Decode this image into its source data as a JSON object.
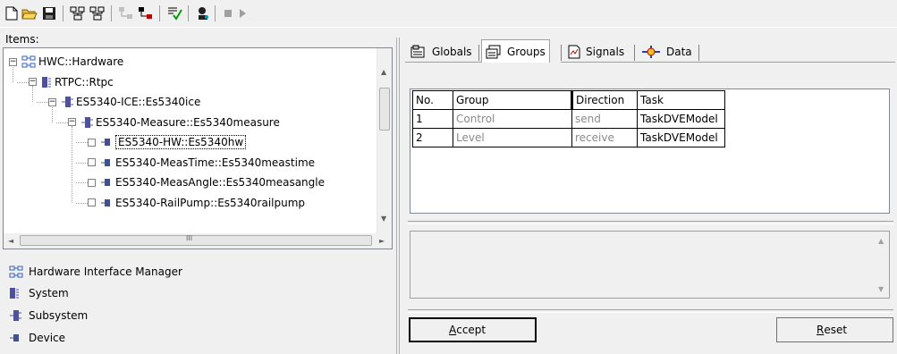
{
  "toolbar": {
    "icons": [
      "new-file-icon",
      "open-folder-icon",
      "save-icon",
      "hardware-config-icon",
      "hardware-config-alt-icon",
      "disabled-network-icon",
      "network-icon",
      "check-icon",
      "user-icon",
      "stop-icon",
      "play-icon"
    ]
  },
  "items_label": "Items:",
  "tree": [
    {
      "label": "HWC::Hardware",
      "level": 0,
      "type": "hardware"
    },
    {
      "label": "RTPC::Rtpc",
      "level": 1,
      "type": "system"
    },
    {
      "label": "ES5340-ICE::Es5340ice",
      "level": 2,
      "type": "subsystem"
    },
    {
      "label": "ES5340-Measure::Es5340measure",
      "level": 3,
      "type": "subsystem"
    },
    {
      "label": "ES5340-HW::Es5340hw",
      "level": 4,
      "type": "device",
      "selected": true
    },
    {
      "label": "ES5340-MeasTime::Es5340meastime",
      "level": 4,
      "type": "device"
    },
    {
      "label": "ES5340-MeasAngle::Es5340measangle",
      "level": 4,
      "type": "device"
    },
    {
      "label": "ES5340-RailPump::Es5340railpump",
      "level": 4,
      "type": "device"
    }
  ],
  "scroll_glyph": "III",
  "legend": [
    {
      "label": "Hardware Interface Manager",
      "icon": "hardware-icon"
    },
    {
      "label": "System",
      "icon": "system-icon"
    },
    {
      "label": "Subsystem",
      "icon": "subsystem-icon"
    },
    {
      "label": "Device",
      "icon": "device-icon"
    }
  ],
  "tabs": [
    {
      "label": "Globals",
      "icon": "globals-icon"
    },
    {
      "label": "Groups",
      "icon": "groups-icon",
      "active": true
    },
    {
      "label": "Signals",
      "icon": "signals-icon"
    },
    {
      "label": "Data",
      "icon": "data-icon"
    }
  ],
  "table": {
    "headers": [
      "No.",
      "Group",
      "Direction",
      "Task"
    ],
    "rows": [
      [
        "1",
        "Control",
        "send",
        "TaskDVEModel"
      ],
      [
        "2",
        "Level",
        "receive",
        "TaskDVEModel"
      ]
    ]
  },
  "buttons": {
    "accept_first": "A",
    "accept_rest": "ccept",
    "reset_first": "R",
    "reset_rest": "eset"
  },
  "colors": {
    "hardware_icon": "#3060c0",
    "system_icon": "#5050a0",
    "device_icon": "#405090"
  }
}
